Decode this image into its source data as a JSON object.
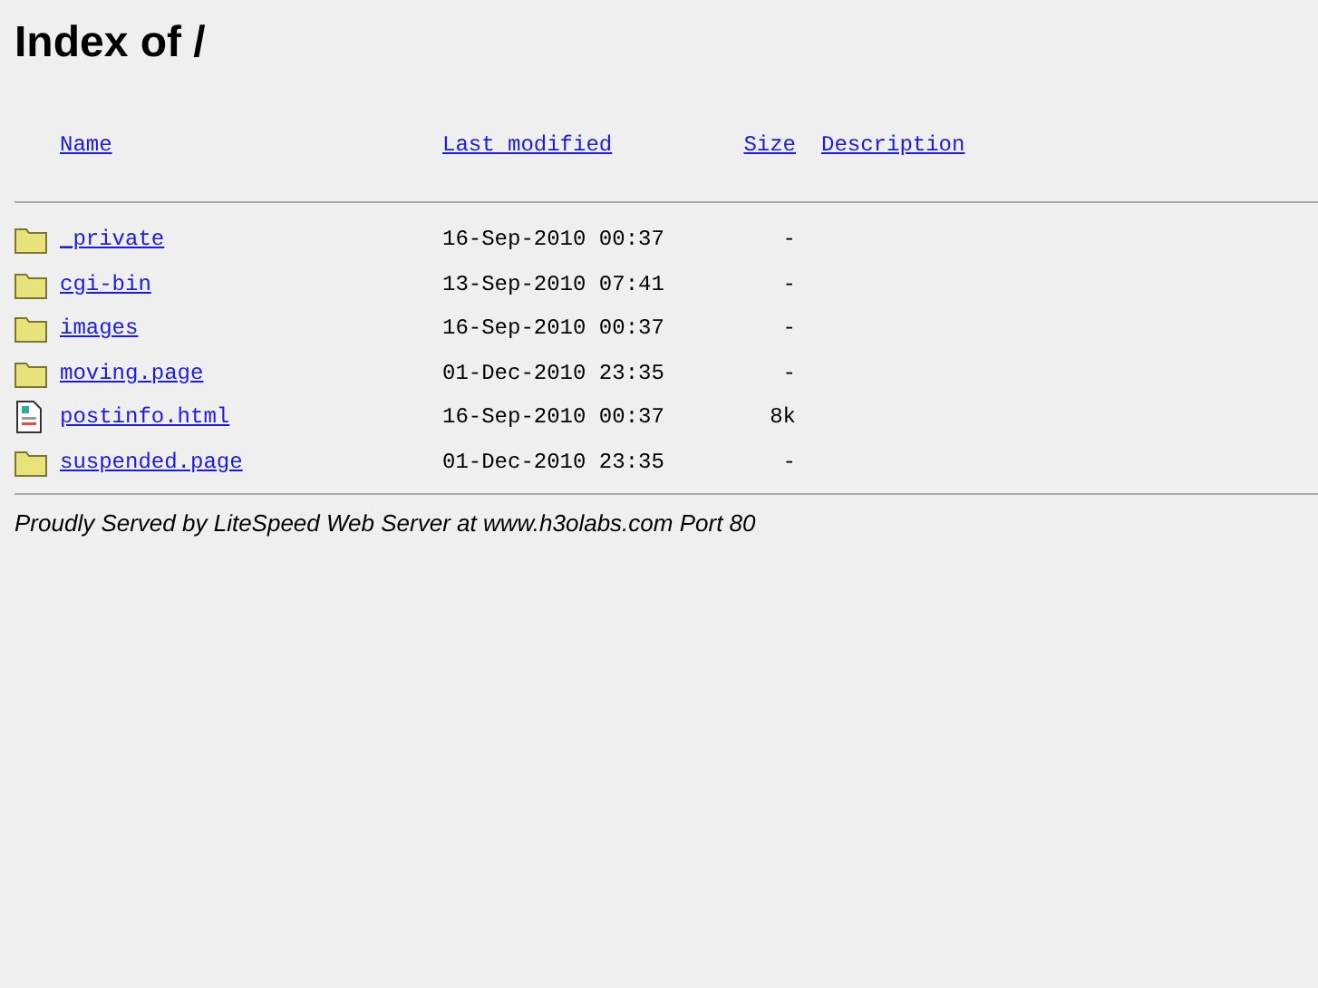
{
  "title": "Index of /",
  "columns": [
    "Name",
    "Last modified",
    "Size",
    "Description"
  ],
  "rows": [
    {
      "kind": "folder",
      "name": "_private",
      "modified": "16-Sep-2010 00:37",
      "size": "-"
    },
    {
      "kind": "folder",
      "name": "cgi-bin",
      "modified": "13-Sep-2010 07:41",
      "size": "-"
    },
    {
      "kind": "folder",
      "name": "images",
      "modified": "16-Sep-2010 00:37",
      "size": "-"
    },
    {
      "kind": "folder",
      "name": "moving.page",
      "modified": "01-Dec-2010 23:35",
      "size": "-"
    },
    {
      "kind": "file",
      "name": "postinfo.html",
      "modified": "16-Sep-2010 00:37",
      "size": "8k"
    },
    {
      "kind": "folder",
      "name": "suspended.page",
      "modified": "01-Dec-2010 23:35",
      "size": "-"
    }
  ],
  "footer": "Proudly Served by LiteSpeed Web Server at www.h3olabs.com Port 80"
}
